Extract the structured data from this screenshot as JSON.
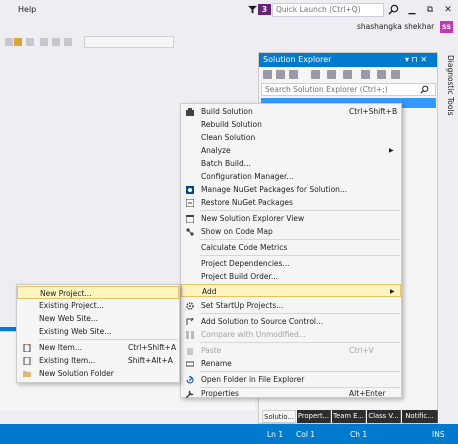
{
  "titlebar": {
    "menu_help": "Help",
    "notification_count": "3",
    "quick_launch_placeholder": "Quick Launch (Ctrl+Q)",
    "user_name": "shashangka shekhar",
    "avatar_initials": "SS"
  },
  "solution_explorer": {
    "title": "Solution Explorer",
    "title_buttons": "▾ ⊓ ✕",
    "search_placeholder": "Search Solution Explorer (Ctrl+;)"
  },
  "diagnostic_tools": "Diagnostic Tools",
  "bottom_tabs": [
    "Solutio...",
    "Propert...",
    "Team E...",
    "Class V...",
    "Notific..."
  ],
  "status_bar": {
    "ln": "Ln 1",
    "col": "Col 1",
    "ch": "Ch 1",
    "mode": "INS"
  },
  "context_menu": {
    "items": [
      {
        "label": "Build Solution",
        "shortcut": "Ctrl+Shift+B",
        "icon": "build-icon"
      },
      {
        "label": "Rebuild Solution",
        "shortcut": ""
      },
      {
        "label": "Clean Solution",
        "shortcut": ""
      },
      {
        "label": "Analyze",
        "shortcut": ""
      },
      {
        "label": "Batch Build...",
        "shortcut": ""
      },
      {
        "label": "Configuration Manager...",
        "shortcut": ""
      },
      {
        "label": "Manage NuGet Packages for Solution...",
        "shortcut": "",
        "icon": "nuget-icon"
      },
      {
        "label": "Restore NuGet Packages",
        "shortcut": "",
        "icon": "restore-icon"
      },
      {
        "label": "New Solution Explorer View",
        "shortcut": "",
        "icon": "new-view-icon"
      },
      {
        "label": "Show on Code Map",
        "shortcut": "",
        "icon": "code-map-icon"
      },
      {
        "label": "Calculate Code Metrics",
        "shortcut": ""
      },
      {
        "label": "Project Dependencies...",
        "shortcut": ""
      },
      {
        "label": "Project Build Order...",
        "shortcut": ""
      },
      {
        "label": "Add",
        "shortcut": ""
      },
      {
        "label": "Set StartUp Projects...",
        "shortcut": "",
        "icon": "gear-icon"
      },
      {
        "label": "Add Solution to Source Control...",
        "shortcut": "",
        "icon": "source-control-icon"
      },
      {
        "label": "Compare with Unmodified...",
        "shortcut": "",
        "icon": "compare-icon"
      },
      {
        "label": "Paste",
        "shortcut": "Ctrl+V",
        "icon": "paste-icon"
      },
      {
        "label": "Rename",
        "shortcut": "",
        "icon": "rename-icon"
      },
      {
        "label": "Open Folder in File Explorer",
        "shortcut": "",
        "icon": "open-folder-icon"
      },
      {
        "label": "Properties",
        "shortcut": "Alt+Enter",
        "icon": "wrench-icon"
      }
    ]
  },
  "add_submenu": {
    "items": [
      {
        "label": "New Project...",
        "shortcut": ""
      },
      {
        "label": "Existing Project...",
        "shortcut": ""
      },
      {
        "label": "New Web Site...",
        "shortcut": ""
      },
      {
        "label": "Existing Web Site...",
        "shortcut": ""
      },
      {
        "label": "New Item...",
        "shortcut": "Ctrl+Shift+A",
        "icon": "new-item-icon"
      },
      {
        "label": "Existing Item...",
        "shortcut": "Shift+Alt+A",
        "icon": "existing-item-icon"
      },
      {
        "label": "New Solution Folder",
        "shortcut": "",
        "icon": "folder-icon"
      }
    ]
  },
  "colors": {
    "accent": "#007acc",
    "highlight": "#fdf4bf",
    "avatar": "#c239b3",
    "badge": "#68217a"
  }
}
